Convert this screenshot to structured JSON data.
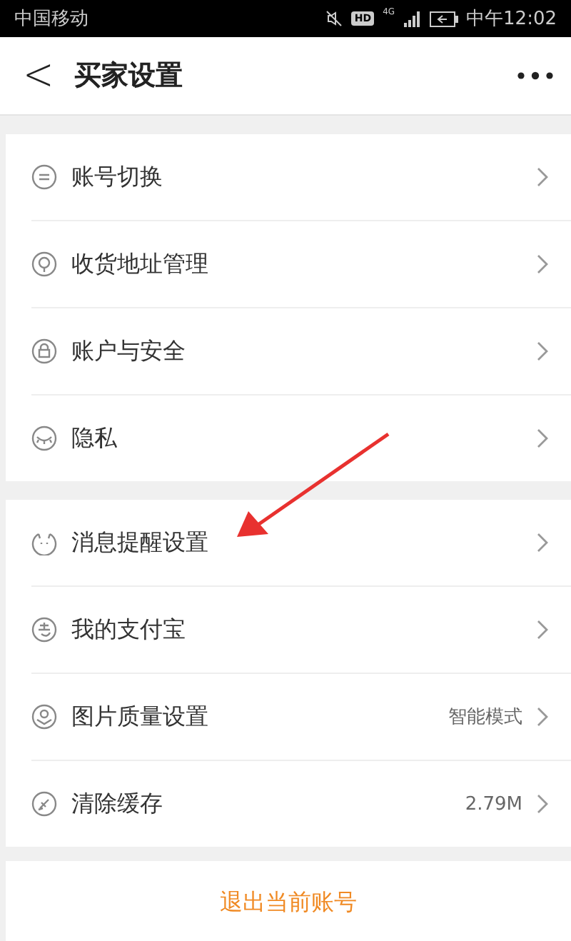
{
  "status_bar": {
    "carrier": "中国移动",
    "hd_badge": "HD",
    "network": "4G",
    "time": "中午12:02"
  },
  "header": {
    "back": "<",
    "title": "买家设置"
  },
  "groups": [
    {
      "items": [
        {
          "label": "账号切换"
        },
        {
          "label": "收货地址管理"
        },
        {
          "label": "账户与安全"
        },
        {
          "label": "隐私"
        }
      ]
    },
    {
      "items": [
        {
          "label": "消息提醒设置"
        },
        {
          "label": "我的支付宝"
        },
        {
          "label": "图片质量设置",
          "value": "智能模式"
        },
        {
          "label": "清除缓存",
          "value": "2.79M"
        }
      ]
    }
  ],
  "logout": "退出当前账号"
}
